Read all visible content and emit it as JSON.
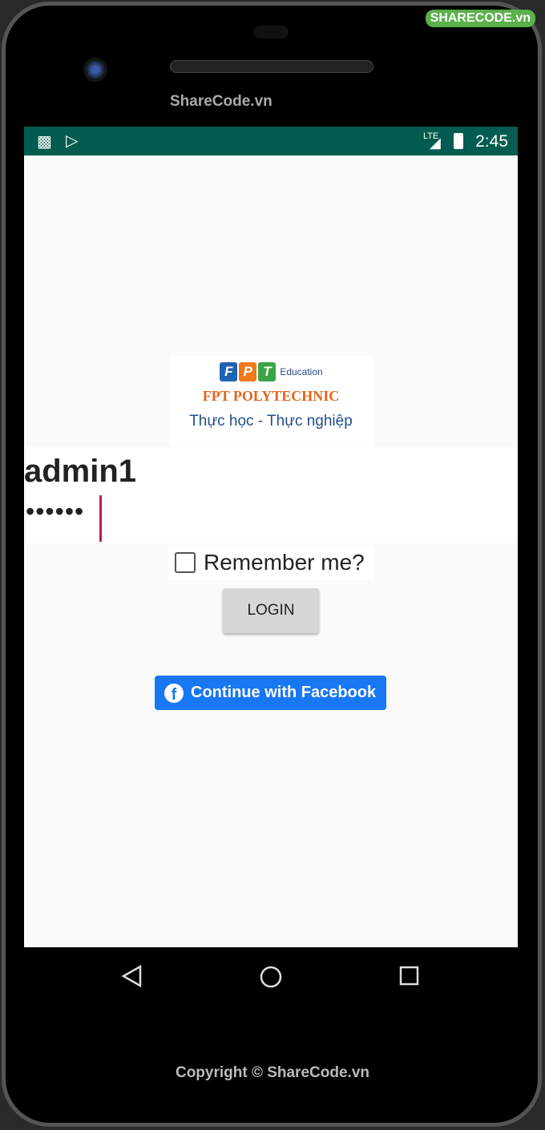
{
  "device": {
    "brand": "ShareCode.vn",
    "watermark": "SHARECODE.vn",
    "copyright": "Copyright © ShareCode.vn"
  },
  "status_bar": {
    "time": "2:45",
    "network": "LTE",
    "icons": [
      "alert-icon",
      "play-store-icon",
      "signal-icon",
      "battery-charging-icon"
    ]
  },
  "logo": {
    "letters": [
      "F",
      "P",
      "T"
    ],
    "sub": "Education",
    "title": "FPT POLYTECHNIC",
    "slogan": "Thực học - Thực nghiệp"
  },
  "form": {
    "username": "admin1",
    "password": "••••••",
    "remember_label": "Remember me?",
    "remember_checked": false,
    "login_label": "LOGIN",
    "facebook_label": "Continue with Facebook"
  },
  "colors": {
    "status": "#035c4f",
    "facebook": "#1877f2",
    "caret": "#c2185b"
  }
}
